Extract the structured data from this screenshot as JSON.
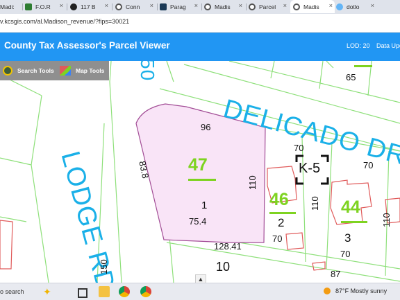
{
  "browser": {
    "tabs": [
      {
        "label": "Madi:"
      },
      {
        "label": "F.O.R"
      },
      {
        "label": "117 B"
      },
      {
        "label": "Conn"
      },
      {
        "label": "Parag"
      },
      {
        "label": "Madis"
      },
      {
        "label": "Parcel"
      },
      {
        "label": "Madis"
      },
      {
        "label": "dotlo"
      }
    ],
    "url": "v.kcsgis.com/al.Madison_revenue/?fips=30021"
  },
  "app": {
    "title": "County Tax Assessor's Parcel Viewer",
    "lod": "LOD: 20",
    "data_label": "Data Upd"
  },
  "tools": {
    "search_label": "Search Tools",
    "map_label": "Map Tools"
  },
  "map": {
    "roads": {
      "delicado": "DELICADO DR",
      "lodge": "LODGE RD",
      "vertical_top": "50"
    },
    "selected_lot": "47",
    "lot_46": "46",
    "lot_44": "44",
    "grid_cell": "K-5",
    "dims": {
      "d96": "96",
      "d83_8": "83.8",
      "d110a": "110",
      "d1": "1",
      "d75_4": "75.4",
      "d128_41": "128.41",
      "d10": "10",
      "d150": "150",
      "d65": "65",
      "d70a": "70",
      "d70b": "70",
      "d2": "2",
      "d110b": "110",
      "d70c": "70",
      "d110c": "110",
      "d3": "3",
      "d70d": "70",
      "d87": "87"
    },
    "colors": {
      "selected_fill": "#f9e4f7",
      "parcel_line": "#8ee07a",
      "building": "#e05a5a",
      "road_label": "#1ab0e8",
      "lot_number": "#7ed321"
    }
  },
  "taskbar": {
    "search": "o search",
    "weather": "87°F  Mostly sunny"
  }
}
